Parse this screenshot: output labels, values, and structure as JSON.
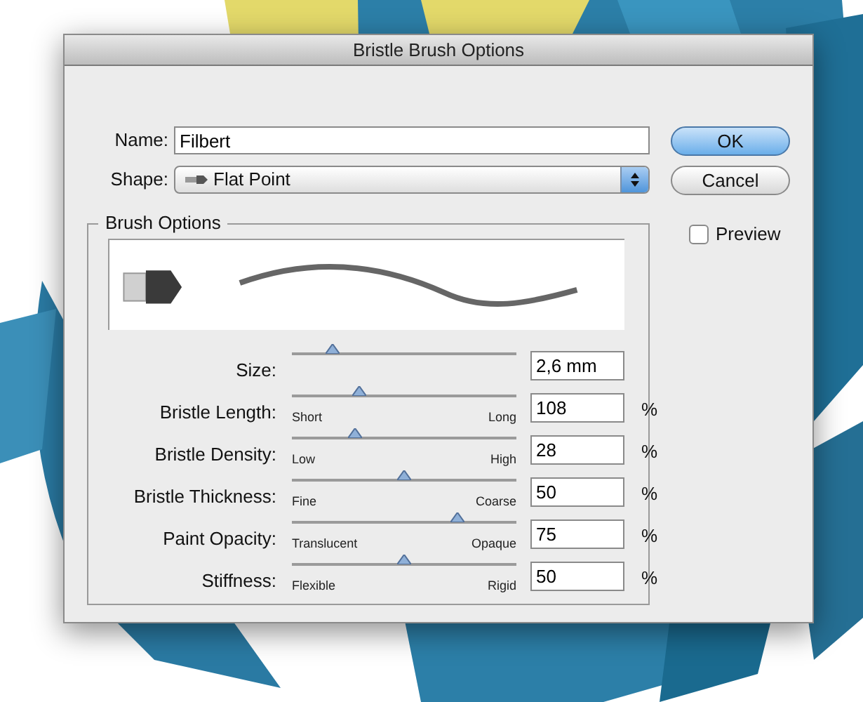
{
  "dialog": {
    "title": "Bristle Brush Options"
  },
  "name_field": {
    "label": "Name:",
    "value": "Filbert"
  },
  "shape": {
    "label": "Shape:",
    "value": "Flat Point"
  },
  "buttons": [
    {
      "label": "OK",
      "kind": "default"
    },
    {
      "label": "Cancel",
      "kind": "normal"
    }
  ],
  "preview": {
    "label": "Preview",
    "checked": false
  },
  "brush_options": {
    "title": "Brush Options",
    "sliders": [
      {
        "label": "Size:",
        "level": 0.18,
        "value": "2,6 mm"
      },
      {
        "label": "Bristle Length:",
        "level": 0.3,
        "min_label": "Short",
        "max_label": "Long",
        "value": "108",
        "unit": "%"
      },
      {
        "label": "Bristle Density:",
        "level": 0.28,
        "min_label": "Low",
        "max_label": "High",
        "value": "28",
        "unit": "%"
      },
      {
        "label": "Bristle Thickness:",
        "level": 0.5,
        "min_label": "Fine",
        "max_label": "Coarse",
        "value": "50",
        "unit": "%"
      },
      {
        "label": "Paint Opacity:",
        "level": 0.74,
        "min_label": "Translucent",
        "max_label": "Opaque",
        "value": "75",
        "unit": "%"
      },
      {
        "label": "Stiffness:",
        "level": 0.5,
        "min_label": "Flexible",
        "max_label": "Rigid",
        "value": "50",
        "unit": "%"
      }
    ]
  }
}
